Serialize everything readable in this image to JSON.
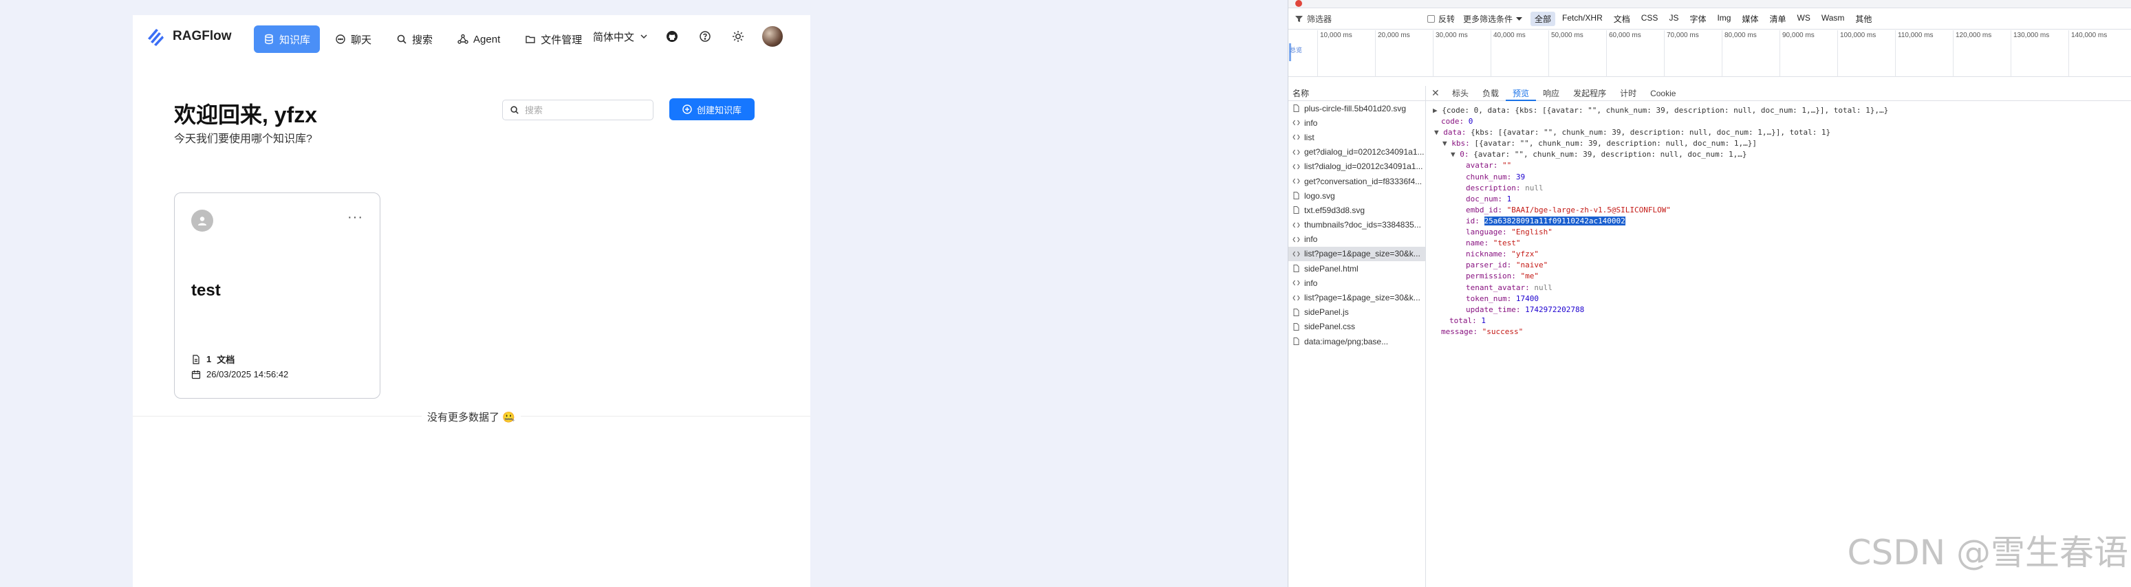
{
  "app": {
    "logo_text": "RAGFlow",
    "nav": [
      {
        "label": "知识库",
        "icon": "database-icon",
        "active": true
      },
      {
        "label": "聊天",
        "icon": "chat-icon",
        "active": false
      },
      {
        "label": "搜索",
        "icon": "search-icon",
        "active": false
      },
      {
        "label": "Agent",
        "icon": "agent-icon",
        "active": false
      },
      {
        "label": "文件管理",
        "icon": "folder-icon",
        "active": false
      }
    ],
    "language": "简体中文",
    "welcome_title": "欢迎回来, yfzx",
    "welcome_subtitle": "今天我们要使用哪个知识库?",
    "search_placeholder": "搜索",
    "create_button": "创建知识库",
    "knowledge_base": {
      "name": "test",
      "docs_count": "1",
      "docs_label": "文档",
      "date": "26/03/2025 14:56:42"
    },
    "no_more_text": "没有更多数据了 🤐",
    "accent_color": "#1677ff"
  },
  "devtools": {
    "filter_placeholder": "筛选器",
    "invert_label": "反转",
    "more_filters_label": "更多筛选条件",
    "type_filters": [
      "全部",
      "Fetch/XHR",
      "文档",
      "CSS",
      "JS",
      "字体",
      "Img",
      "媒体",
      "清单",
      "WS",
      "Wasm",
      "其他"
    ],
    "timeline_ticks": [
      "10,000 ms",
      "20,000 ms",
      "30,000 ms",
      "40,000 ms",
      "50,000 ms",
      "60,000 ms",
      "70,000 ms",
      "80,000 ms",
      "90,000 ms",
      "100,000 ms",
      "110,000 ms",
      "120,000 ms",
      "130,000 ms",
      "140,000 ms"
    ],
    "timeline_label": "总览",
    "name_header": "名称",
    "requests": [
      "plus-circle-fill.5b401d20.svg",
      "info",
      "list",
      "get?dialog_id=02012c34091a1...",
      "list?dialog_id=02012c34091a1...",
      "get?conversation_id=f83336f4...",
      "logo.svg",
      "txt.ef59d3d8.svg",
      "thumbnails?doc_ids=3384835...",
      "info",
      "list?page=1&page_size=30&k...",
      "sidePanel.html",
      "info",
      "list?page=1&page_size=30&k...",
      "sidePanel.js",
      "sidePanel.css",
      "data:image/png;base..."
    ],
    "selected_index": 10,
    "detail_tabs": [
      "标头",
      "负载",
      "预览",
      "响应",
      "发起程序",
      "计时",
      "Cookie"
    ],
    "active_tab": 2,
    "preview": {
      "root_summary": "{code: 0, data: {kbs: [{avatar: \"\", chunk_num: 39, description: null, doc_num: 1,…}], total: 1},…}",
      "code": "0",
      "data_summary": "{kbs: [{avatar: \"\", chunk_num: 39, description: null, doc_num: 1,…}], total: 1}",
      "kbs_summary": "[{avatar: \"\", chunk_num: 39, description: null, doc_num: 1,…}]",
      "item_summary": "{avatar: \"\", chunk_num: 39, description: null, doc_num: 1,…}",
      "avatar": "\"\"",
      "chunk_num": "39",
      "description": "null",
      "doc_num": "1",
      "embd_id": "\"BAAI/bge-large-zh-v1.5@SILICONFLOW\"",
      "id": "25a63828091a11f09110242ac140002",
      "language": "\"English\"",
      "name": "\"test\"",
      "nickname": "\"yfzx\"",
      "parser_id": "\"naive\"",
      "permission": "\"me\"",
      "tenant_avatar": "null",
      "token_num": "17400",
      "update_time": "1742972202788",
      "total": "1",
      "message": "\"success\""
    },
    "watermark": "CSDN @雪生春语"
  }
}
